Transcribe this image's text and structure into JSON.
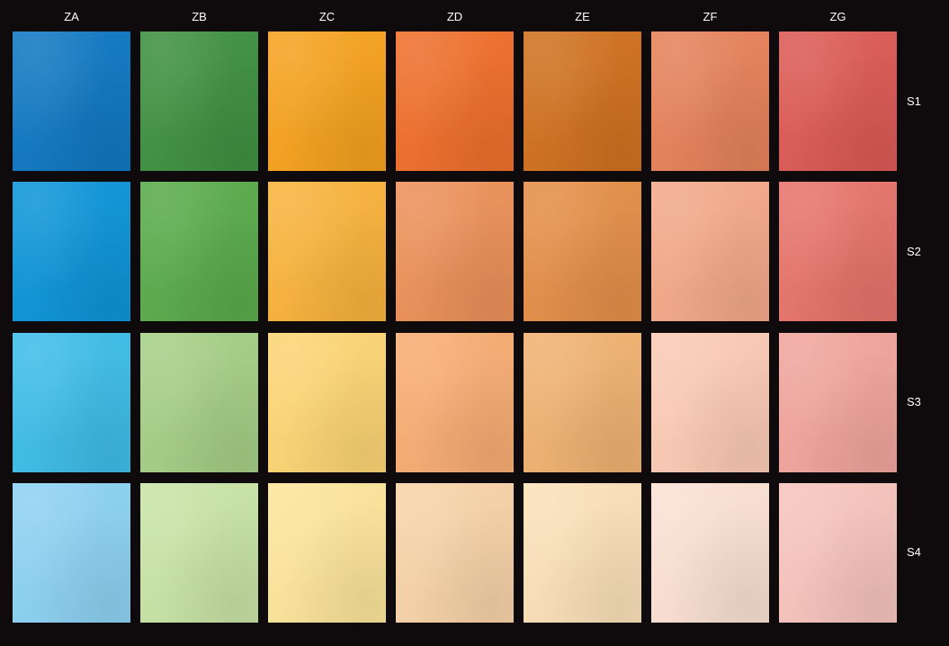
{
  "columns": [
    "ZA",
    "ZB",
    "ZC",
    "ZD",
    "ZE",
    "ZF",
    "ZG"
  ],
  "rows": [
    "S1",
    "S2",
    "S3",
    "S4"
  ],
  "swatch_colors": [
    [
      "#1078c2",
      "#3e9141",
      "#f6a21e",
      "#ef6f2b",
      "#d0711f",
      "#e6825a",
      "#dc5a55"
    ],
    [
      "#0d95d8",
      "#5aab4b",
      "#f9b33c",
      "#ec9159",
      "#e48f48",
      "#f3a989",
      "#e6746b"
    ],
    [
      "#3ebde8",
      "#a6cf86",
      "#fdd574",
      "#f8ad73",
      "#f0b271",
      "#fbcbb5",
      "#f1a59d"
    ],
    [
      "#8dd2f3",
      "#c9e4a6",
      "#fde59b",
      "#f8d3a8",
      "#fbe1b9",
      "#fbe1d3",
      "#f7c4bd"
    ]
  ],
  "background_color": "#0f0a0b"
}
